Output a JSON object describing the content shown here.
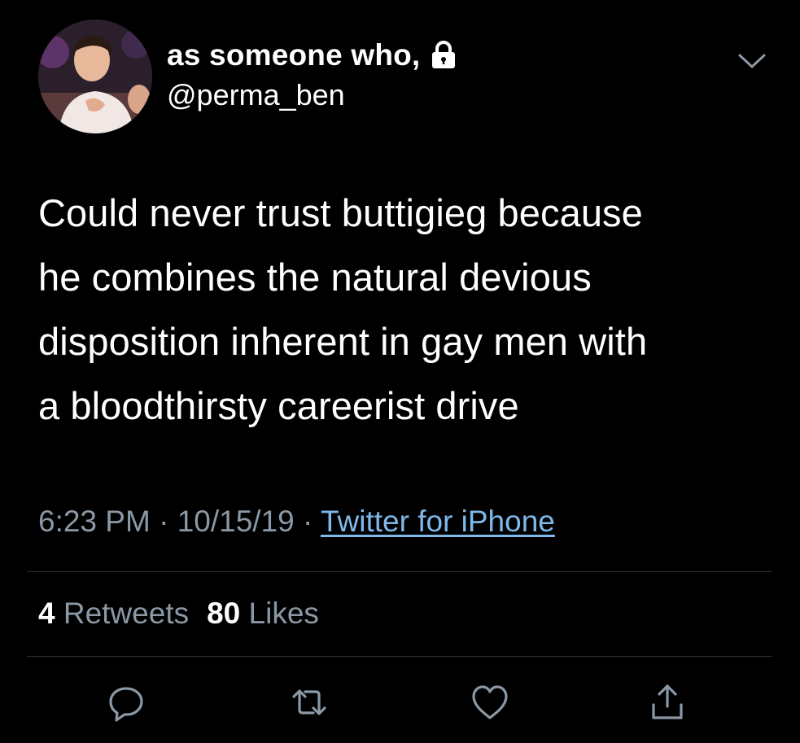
{
  "user": {
    "display_name": "as someone who,",
    "handle": "@perma_ben",
    "protected_icon": "lock-icon"
  },
  "tweet": {
    "text": "Could never trust buttigieg because he combines the natural devious disposition inherent in gay men with a bloodthirsty careerist drive",
    "lines": [
      "Could never trust buttigieg because",
      "he combines the natural devious",
      "disposition inherent in gay men with",
      "a bloodthirsty careerist drive"
    ],
    "time": "6:23 PM",
    "separator": "·",
    "date": "10/15/19",
    "source": "Twitter for iPhone"
  },
  "stats": {
    "retweets_count": "4",
    "retweets_label": "Retweets",
    "likes_count": "80",
    "likes_label": "Likes"
  },
  "actions": [
    {
      "name": "reply",
      "icon": "reply-icon"
    },
    {
      "name": "retweet",
      "icon": "retweet-icon"
    },
    {
      "name": "like",
      "icon": "heart-icon"
    },
    {
      "name": "share",
      "icon": "share-icon"
    }
  ],
  "colors": {
    "background": "#000000",
    "text": "#ffffff",
    "secondary": "#8b98a5",
    "link": "#7fb8ea",
    "divider": "#2f3336"
  }
}
